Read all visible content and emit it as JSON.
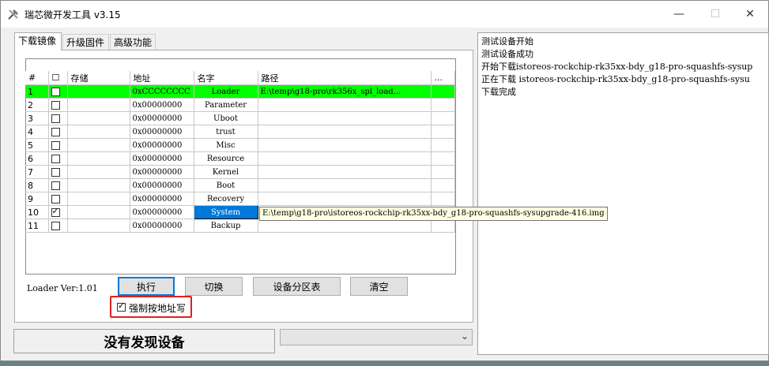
{
  "window": {
    "title": "瑞芯微开发工具 v3.15",
    "controls": {
      "minimize": "—",
      "maximize": "☐",
      "close": "✕"
    }
  },
  "tabs": [
    {
      "label": "下载镜像",
      "active": true
    },
    {
      "label": "升级固件",
      "active": false
    },
    {
      "label": "高级功能",
      "active": false
    }
  ],
  "table": {
    "headers": [
      "#",
      "☐",
      "存储",
      "地址",
      "名字",
      "路径",
      "..."
    ],
    "rows": [
      {
        "num": "1",
        "checked": false,
        "storage": "",
        "address": "0xCCCCCCCC",
        "name": "Loader",
        "path": "E:\\temp\\g18-pro\\rk356x_spl_load...",
        "selected": true
      },
      {
        "num": "2",
        "checked": false,
        "storage": "",
        "address": "0x00000000",
        "name": "Parameter",
        "path": ""
      },
      {
        "num": "3",
        "checked": false,
        "storage": "",
        "address": "0x00000000",
        "name": "Uboot",
        "path": ""
      },
      {
        "num": "4",
        "checked": false,
        "storage": "",
        "address": "0x00000000",
        "name": "trust",
        "path": ""
      },
      {
        "num": "5",
        "checked": false,
        "storage": "",
        "address": "0x00000000",
        "name": "Misc",
        "path": ""
      },
      {
        "num": "6",
        "checked": false,
        "storage": "",
        "address": "0x00000000",
        "name": "Resource",
        "path": ""
      },
      {
        "num": "7",
        "checked": false,
        "storage": "",
        "address": "0x00000000",
        "name": "Kernel",
        "path": ""
      },
      {
        "num": "8",
        "checked": false,
        "storage": "",
        "address": "0x00000000",
        "name": "Boot",
        "path": ""
      },
      {
        "num": "9",
        "checked": false,
        "storage": "",
        "address": "0x00000000",
        "name": "Recovery",
        "path": ""
      },
      {
        "num": "10",
        "checked": true,
        "storage": "",
        "address": "0x00000000",
        "name": "System",
        "path": "",
        "active": true
      },
      {
        "num": "11",
        "checked": false,
        "storage": "",
        "address": "0x00000000",
        "name": "Backup",
        "path": ""
      }
    ],
    "tooltip": "E:\\temp\\g18-pro\\istoreos-rockchip-rk35xx-bdy_g18-pro-squashfs-sysupgrade-416.img"
  },
  "loader_version": "Loader Ver:1.01",
  "buttons": {
    "run": "执行",
    "switch": "切换",
    "partition_table": "设备分区表",
    "clear": "清空"
  },
  "force_address": {
    "label": "强制按地址写",
    "checked": true
  },
  "status": "没有发现设备",
  "combo_value": "",
  "log": [
    "测试设备开始",
    "测试设备成功",
    "开始下载istoreos-rockchip-rk35xx-bdy_g18-pro-squashfs-sysup",
    "正在下载 istoreos-rockchip-rk35xx-bdy_g18-pro-squashfs-sysu",
    "下载完成"
  ],
  "colors": {
    "selected_row": "#00ff00",
    "active_cell": "#0078d7",
    "highlight_box": "#e02020",
    "tooltip_bg": "#ffffe1"
  }
}
